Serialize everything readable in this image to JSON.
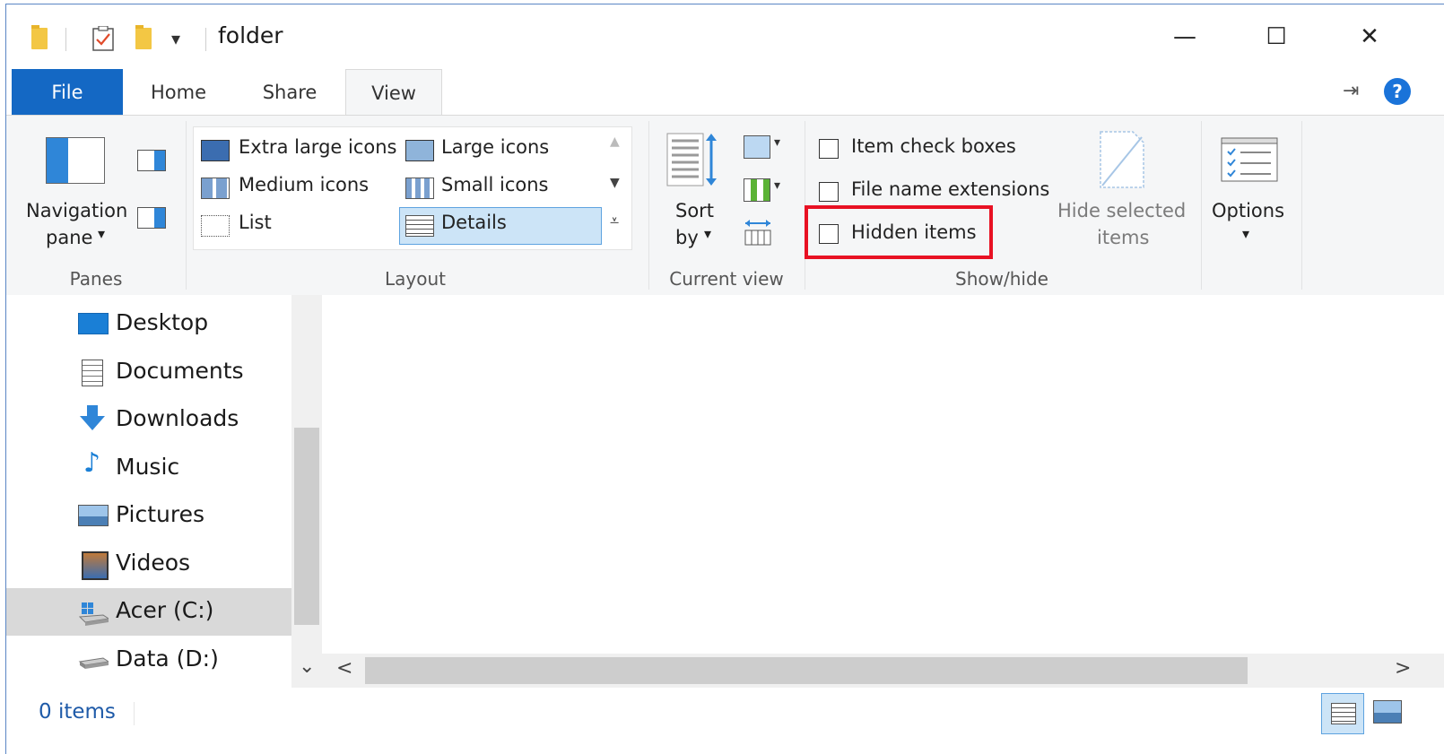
{
  "window": {
    "title": "folder",
    "qat_dropdown_glyph": "▾",
    "minimize_glyph": "—",
    "maximize_glyph": "☐",
    "close_glyph": "✕"
  },
  "tabs": [
    {
      "label": "File"
    },
    {
      "label": "Home"
    },
    {
      "label": "Share"
    },
    {
      "label": "View"
    }
  ],
  "ribbon_right": {
    "help_glyph": "?",
    "pin_glyph": "⇥"
  },
  "panes": {
    "navigation_pane_line1": "Navigation",
    "navigation_pane_line2": "pane",
    "dropdown_glyph": "▾",
    "group_label": "Panes"
  },
  "layout": {
    "options": [
      {
        "label": "Extra large icons"
      },
      {
        "label": "Large icons"
      },
      {
        "label": "Medium icons"
      },
      {
        "label": "Small icons"
      },
      {
        "label": "List"
      },
      {
        "label": "Details"
      }
    ],
    "selected": "Details",
    "group_label": "Layout"
  },
  "current_view": {
    "sort_line1": "Sort",
    "sort_line2": "by",
    "dropdown_glyph": "▾",
    "group_label": "Current view"
  },
  "show_hide": {
    "item_check_boxes": "Item check boxes",
    "file_name_extensions": "File name extensions",
    "hidden_items": "Hidden items",
    "hide_selected_line1": "Hide selected",
    "hide_selected_line2": "items",
    "group_label": "Show/hide"
  },
  "options": {
    "label": "Options",
    "dropdown_glyph": "▾"
  },
  "nav_items": [
    {
      "label": "Desktop",
      "icon": "desktop-icon"
    },
    {
      "label": "Documents",
      "icon": "documents-icon"
    },
    {
      "label": "Downloads",
      "icon": "downloads-icon"
    },
    {
      "label": "Music",
      "icon": "music-icon"
    },
    {
      "label": "Pictures",
      "icon": "pictures-icon"
    },
    {
      "label": "Videos",
      "icon": "videos-icon"
    },
    {
      "label": "Acer (C:)",
      "icon": "drive-c-icon",
      "selected": true
    },
    {
      "label": "Data (D:)",
      "icon": "drive-d-icon"
    }
  ],
  "scroll": {
    "down_glyph": "⌄",
    "left_glyph": "<",
    "right_glyph": ">"
  },
  "status": {
    "items_count": "0 items"
  },
  "colors": {
    "accent": "#1468c4",
    "highlight": "#e81123",
    "selection": "#cce4f7"
  }
}
